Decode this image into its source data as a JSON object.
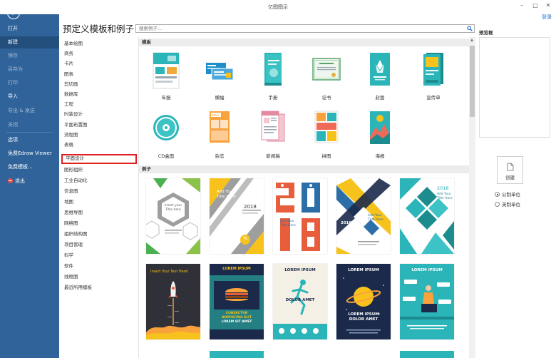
{
  "window": {
    "title": "亿图图示",
    "minimize": "–",
    "maximize": "□",
    "close": "✕",
    "login": "登录"
  },
  "sidebar": {
    "items": [
      {
        "label": "打开",
        "state": "normal"
      },
      {
        "label": "新建",
        "state": "active"
      },
      {
        "label": "保存",
        "state": "dim"
      },
      {
        "label": "另存为",
        "state": "dim"
      },
      {
        "label": "打印",
        "state": "dim"
      },
      {
        "label": "导入",
        "state": "normal"
      },
      {
        "label": "导出 & 发送",
        "state": "dim"
      },
      {
        "label": "关闭",
        "state": "dim"
      },
      {
        "label": "选项",
        "state": "normal"
      },
      {
        "label": "免费Edraw Viewer",
        "state": "normal"
      },
      {
        "label": "免费模板...",
        "state": "normal"
      },
      {
        "label": "退出",
        "state": "normal"
      }
    ]
  },
  "page": {
    "title": "预定义模板和例子",
    "search_placeholder": "搜索例子..."
  },
  "categories": [
    "基本绘图",
    "商务",
    "卡片",
    "图表",
    "剪切画",
    "数据库",
    "工程",
    "时装设计",
    "平面布置图",
    "流程图",
    "表格",
    "平面设计",
    "图形组织",
    "工业自动化",
    "信息图",
    "地图",
    "思维导图",
    "网络图",
    "组织结构图",
    "项目管理",
    "科学",
    "软件",
    "线框图",
    "最近所用模板"
  ],
  "selected_category": "平面设计",
  "templates": {
    "heading": "模板",
    "items": [
      {
        "label": "年报",
        "icon": "annual-report-icon"
      },
      {
        "label": "横幅",
        "icon": "banner-icon"
      },
      {
        "label": "手册",
        "icon": "manual-icon"
      },
      {
        "label": "证书",
        "icon": "certificate-icon"
      },
      {
        "label": "封面",
        "icon": "cover-icon"
      },
      {
        "label": "宣传单",
        "icon": "flyer-icon"
      },
      {
        "label": "CD盒面",
        "icon": "cd-icon"
      },
      {
        "label": "杂志",
        "icon": "magazine-icon"
      },
      {
        "label": "新闻稿",
        "icon": "newsletter-icon"
      },
      {
        "label": "拼图",
        "icon": "collage-icon"
      },
      {
        "label": "海报",
        "icon": "poster-icon"
      }
    ]
  },
  "examples": {
    "heading": "例子",
    "items": [
      {
        "name": "hexagon-poster",
        "text1": "Insert your",
        "text2": "Title here"
      },
      {
        "name": "yellow-gray-poster",
        "text1": "Add Your",
        "text2": "Title Here",
        "year": "2018",
        "mark": "%"
      },
      {
        "name": "number-2018-poster",
        "text1": "Add Your",
        "text2": "Title Here"
      },
      {
        "name": "chevron-poster",
        "year": "2018",
        "text1": "Add Your",
        "text2": "Title Here"
      },
      {
        "name": "teal-diamond-poster",
        "year": "2018",
        "text1": "Add Your",
        "text2": "Title Here"
      },
      {
        "name": "rocket-poster",
        "text1": "Insert Your Text Here!"
      },
      {
        "name": "burger-poster",
        "text1": "LOREM IPSUM",
        "text2": "CONSECTUR",
        "text3": "ADIPISCING ELIT",
        "text4": "LOREM SIT AMET"
      },
      {
        "name": "runner-poster",
        "text1": "LOREM IPSUM",
        "text2": "DOLOR AMET"
      },
      {
        "name": "planet-poster",
        "text1": "LOREM IPSUM",
        "text2": "LOREM IPSUM",
        "text3": "DOLOR AMET"
      },
      {
        "name": "reader-poster",
        "text1": "LOREM IPSUM"
      }
    ]
  },
  "preview": {
    "title": "预览框",
    "create_label": "创建",
    "units": [
      {
        "label": "公制单位",
        "checked": true
      },
      {
        "label": "英制单位",
        "checked": false
      }
    ]
  },
  "colors": {
    "sidebar": "#2f6399",
    "sidebar_active": "#234f7d",
    "teal": "#2bb5b8",
    "selection_border": "#e02020",
    "accent_yellow": "#f7c21b",
    "navy": "#1b2a4a"
  }
}
